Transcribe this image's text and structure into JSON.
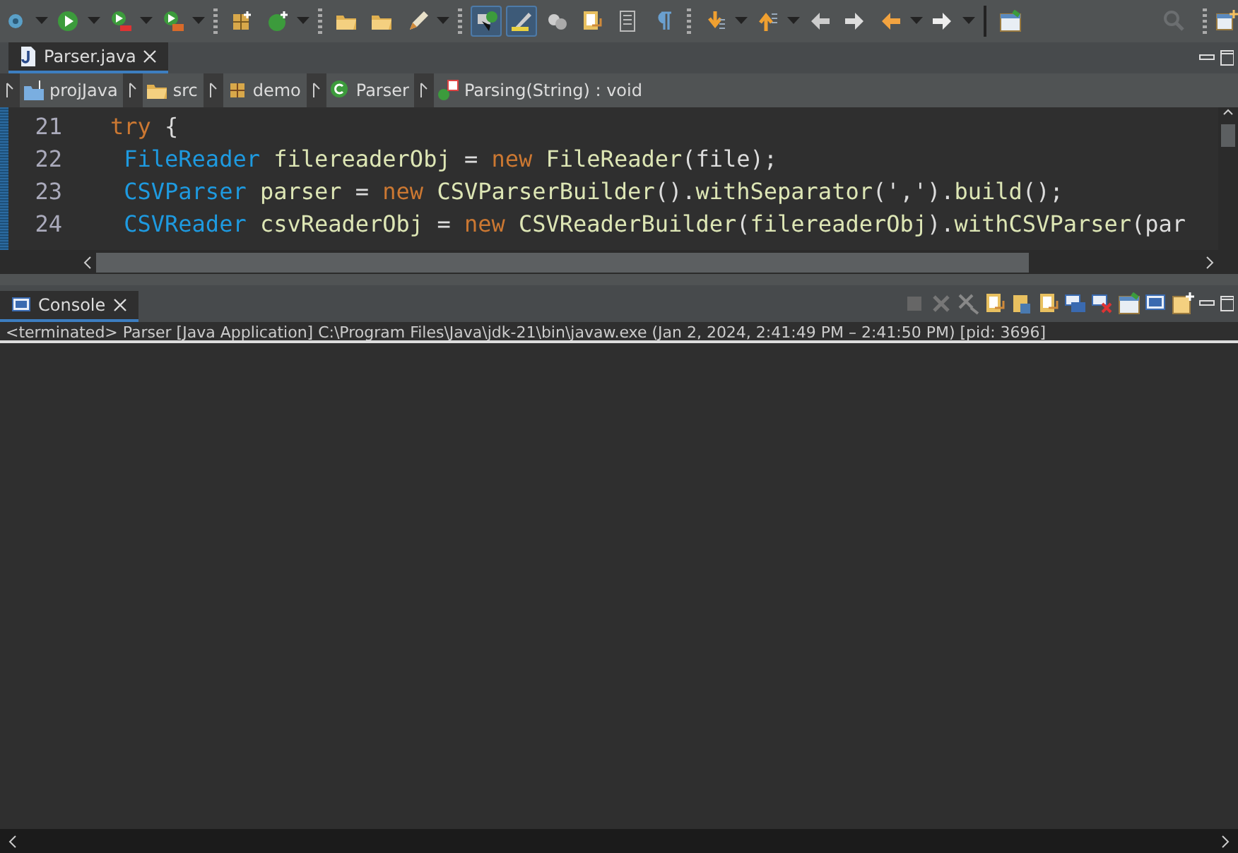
{
  "toolbar": {
    "buttons": [
      {
        "pressed": false
      },
      {
        "pressed": false
      },
      {
        "pressed": false
      },
      {
        "pressed": false
      },
      {
        "pressed": false
      },
      {
        "pressed": false
      },
      {
        "pressed": false
      },
      {
        "pressed": false
      },
      {
        "pressed": false
      },
      {
        "pressed": true
      },
      {
        "pressed": true
      },
      {
        "pressed": false
      },
      {
        "pressed": false
      },
      {
        "pressed": false
      },
      {
        "pressed": false
      },
      {
        "pressed": false
      },
      {
        "pressed": false
      },
      {
        "pressed": false
      },
      {
        "pressed": false
      },
      {
        "pressed": false
      },
      {
        "pressed": false
      },
      {
        "pressed": false
      }
    ]
  },
  "editor": {
    "tabs": [
      {
        "label": "Parser.java",
        "selected": true
      }
    ],
    "breadcrumb": [
      {
        "label": "projJava"
      },
      {
        "label": "src"
      },
      {
        "label": "demo"
      },
      {
        "label": "Parser"
      },
      {
        "label": "Parsing(String) : void"
      }
    ],
    "lines": [
      {
        "number": "21",
        "tokens": [
          {
            "kind": "keyword",
            "text": "try"
          },
          {
            "kind": "plain",
            "text": " {"
          }
        ]
      },
      {
        "number": "22",
        "tokens": [
          {
            "kind": "type",
            "text": " FileReader"
          },
          {
            "kind": "ident",
            "text": " filereaderObj "
          },
          {
            "kind": "plain",
            "text": "= "
          },
          {
            "kind": "keyword",
            "text": "new"
          },
          {
            "kind": "ident",
            "text": " FileReader"
          },
          {
            "kind": "plain",
            "text": "(file);"
          }
        ]
      },
      {
        "number": "23",
        "tokens": [
          {
            "kind": "type",
            "text": " CSVParser"
          },
          {
            "kind": "ident",
            "text": " parser "
          },
          {
            "kind": "plain",
            "text": "= "
          },
          {
            "kind": "keyword",
            "text": "new"
          },
          {
            "kind": "ident",
            "text": " CSVParserBuilder"
          },
          {
            "kind": "plain",
            "text": "()."
          },
          {
            "kind": "ident",
            "text": "withSeparator"
          },
          {
            "kind": "plain",
            "text": "(',')."
          },
          {
            "kind": "ident",
            "text": "build"
          },
          {
            "kind": "plain",
            "text": "();"
          }
        ]
      },
      {
        "number": "24",
        "tokens": [
          {
            "kind": "type",
            "text": " CSVReader"
          },
          {
            "kind": "ident",
            "text": " csvReaderObj "
          },
          {
            "kind": "plain",
            "text": "= "
          },
          {
            "kind": "keyword",
            "text": "new"
          },
          {
            "kind": "ident",
            "text": " CSVReaderBuilder"
          },
          {
            "kind": "plain",
            "text": "("
          },
          {
            "kind": "ident",
            "text": "filereaderObj"
          },
          {
            "kind": "plain",
            "text": ")."
          },
          {
            "kind": "ident",
            "text": "withCSVParser"
          },
          {
            "kind": "plain",
            "text": "(par"
          }
        ]
      }
    ]
  },
  "console": {
    "tabs": [
      {
        "label": "Console",
        "selected": true
      }
    ],
    "status": "<terminated> Parser [Java Application] C:\\Program Files\\Java\\jdk-21\\bin\\javaw.exe  (Jan 2, 2024, 2:41:49 PM – 2:41:50 PM) [pid: 3696]"
  }
}
